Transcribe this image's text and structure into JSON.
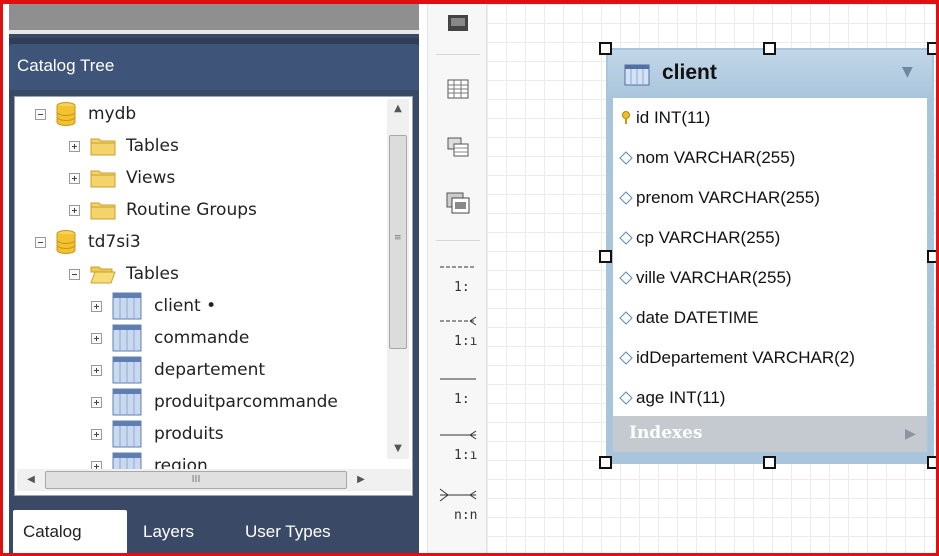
{
  "catalog": {
    "title": "Catalog Tree",
    "tree": [
      {
        "label": "mydb",
        "kind": "database",
        "expander": "minus"
      },
      {
        "label": "Tables",
        "kind": "folder",
        "expander": "plus"
      },
      {
        "label": "Views",
        "kind": "folder",
        "expander": "plus"
      },
      {
        "label": "Routine Groups",
        "kind": "folder",
        "expander": "plus"
      },
      {
        "label": "td7si3",
        "kind": "database",
        "expander": "minus"
      },
      {
        "label": "Tables",
        "kind": "folder-open",
        "expander": "minus"
      },
      {
        "label": "client •",
        "kind": "table",
        "expander": "plus"
      },
      {
        "label": "commande",
        "kind": "table",
        "expander": "plus"
      },
      {
        "label": "departement",
        "kind": "table",
        "expander": "plus"
      },
      {
        "label": "produitparcommande",
        "kind": "table",
        "expander": "plus"
      },
      {
        "label": "produits",
        "kind": "table",
        "expander": "plus"
      },
      {
        "label": "region",
        "kind": "table",
        "expander": "plus"
      }
    ],
    "tabs": [
      "Catalog",
      "Layers",
      "User Types"
    ],
    "active_tab": "Catalog",
    "hscroll_grip": "III",
    "vscroll_grip": "≡"
  },
  "toolbar": {
    "tools": [
      "image-tool-icon",
      "table-tool-icon",
      "view-tool-icon",
      "routine-group-tool-icon"
    ],
    "relationships": [
      "1:",
      "1:ı",
      "1:",
      "1:ı",
      "n:n"
    ]
  },
  "entity": {
    "name": "client",
    "columns": [
      {
        "text": "id INT(11)",
        "icon": "primary-key-icon"
      },
      {
        "text": "nom VARCHAR(255)",
        "icon": "column-diamond-icon"
      },
      {
        "text": "prenom VARCHAR(255)",
        "icon": "column-diamond-icon"
      },
      {
        "text": "cp VARCHAR(255)",
        "icon": "column-diamond-icon"
      },
      {
        "text": "ville VARCHAR(255)",
        "icon": "column-diamond-icon"
      },
      {
        "text": "date DATETIME",
        "icon": "column-diamond-icon"
      },
      {
        "text": "idDepartement VARCHAR(2)",
        "icon": "column-diamond-icon"
      },
      {
        "text": "age INT(11)",
        "icon": "column-diamond-icon"
      }
    ],
    "indexes_label": "Indexes"
  },
  "colors": {
    "frame": "#e01010",
    "panel_dark": "#3a4a66",
    "panel_header": "#3f5479",
    "entity_header": "#a9c5dc",
    "indexes_bar": "#c5cad1",
    "db_icon": "#f2c230",
    "folder_icon": "#f2c94c"
  }
}
